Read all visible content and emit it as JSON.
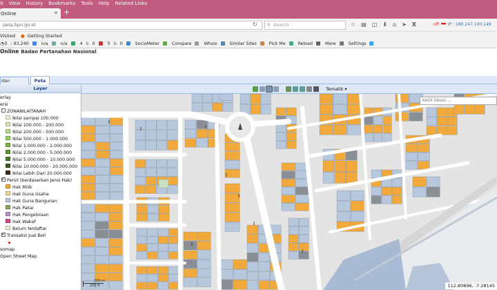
{
  "browser": {
    "menu": [
      "it",
      "View",
      "History",
      "Bookmarks",
      "Tools",
      "Help",
      "Related Links"
    ],
    "tab_title": "Online",
    "url": "peta.bpn.go.id",
    "search_placeholder": "Search",
    "ip_status": "off",
    "ip_label": "IP : 180.247.100.149",
    "bookmarks": [
      "Visited",
      "Getting Started"
    ],
    "seo_items": [
      "0",
      ": 93,240",
      "n/a",
      "n/a",
      "4",
      "0",
      "5",
      "0",
      "SocioMeter",
      "Compare",
      "Whois",
      "Similar Sites",
      "Pick Me",
      "Reload",
      "More",
      "Settings"
    ]
  },
  "site": {
    "title": "Online",
    "subtitle": "Badan Pertanahan Nasional"
  },
  "tabs": {
    "tab1": "dan Ketentuan",
    "tab2": "Peta"
  },
  "layer_panel": {
    "title": "Layer",
    "items": [
      {
        "label": "erlay",
        "indent": 1,
        "type": "text"
      },
      {
        "label": "ersi",
        "indent": 1,
        "type": "text"
      },
      {
        "label": "ZONANILAITANAH",
        "indent": 2,
        "type": "check",
        "checked": false
      },
      {
        "label": "Nilai sampai 100.000",
        "indent": 3,
        "type": "swatch",
        "color": "#e8f5d0"
      },
      {
        "label": "Nilai 100.000 - 200.000",
        "indent": 3,
        "type": "swatch",
        "color": "#d4edb0"
      },
      {
        "label": "Nilai 200.000 - 500.000",
        "indent": 3,
        "type": "swatch",
        "color": "#b8dc88"
      },
      {
        "label": "Nilai 500.000 - 1.000.000",
        "indent": 3,
        "type": "swatch",
        "color": "#9ccc64"
      },
      {
        "label": "Nilai 1.000.000 - 2.000.000",
        "indent": 3,
        "type": "swatch",
        "color": "#7eb548"
      },
      {
        "label": "Nilai 2.000.000 - 5.000.000",
        "indent": 3,
        "type": "swatch",
        "color": "#5f9a34"
      },
      {
        "label": "Nilai 5.000.000 - 10.000.000",
        "indent": 3,
        "type": "swatch",
        "color": "#4a7d28"
      },
      {
        "label": "Nilai 10.000.000 - 20.000.000",
        "indent": 3,
        "type": "swatch",
        "color": "#3d5a20"
      },
      {
        "label": "Nilai Lebih Dari 20.000.000",
        "indent": 3,
        "type": "swatch",
        "color": "#3a2a20"
      },
      {
        "label": "Persil (berdasarkan Jenis Hak)",
        "indent": 2,
        "type": "check",
        "checked": true
      },
      {
        "label": "Hak Milik",
        "indent": 3,
        "type": "swatch",
        "color": "#f2a93b"
      },
      {
        "label": "Hak Guna Usaha",
        "indent": 3,
        "type": "swatch",
        "color": "#e8dc9a"
      },
      {
        "label": "Hak Guna Bangunan",
        "indent": 3,
        "type": "swatch",
        "color": "#b8c8dc"
      },
      {
        "label": "Hak Pakai",
        "indent": 3,
        "type": "swatch",
        "color": "#8aa860"
      },
      {
        "label": "Hak Pengelolaan",
        "indent": 3,
        "type": "swatch",
        "color": "#b894c8"
      },
      {
        "label": "Hak Wakaf",
        "indent": 3,
        "type": "swatch",
        "color": "#d24f8e"
      },
      {
        "label": "Belum terdaftar",
        "indent": 3,
        "type": "swatch",
        "color": "#f4eed8"
      },
      {
        "label": "Transaksi Jual Beli",
        "indent": 2,
        "type": "check",
        "checked": true
      },
      {
        "label": "",
        "indent": 2,
        "type": "dot"
      },
      {
        "label": "somap",
        "indent": 1,
        "type": "text"
      },
      {
        "label": "Open Street Map",
        "indent": 1,
        "type": "text"
      }
    ]
  },
  "map_toolbar": {
    "tematik_label": "Tematik"
  },
  "map": {
    "search_placeholder": "Ketik lokasi ...",
    "coordinates": "112.80896, -7.28145",
    "scale_top": "200 m",
    "scale_bottom": "200 ft",
    "colors": {
      "background": "#e4e4e4",
      "road": "#ffffff",
      "parcel_hgb": "#b8c8dc",
      "parcel_hm": "#f2a93b",
      "water": "#9fb4d0"
    }
  }
}
